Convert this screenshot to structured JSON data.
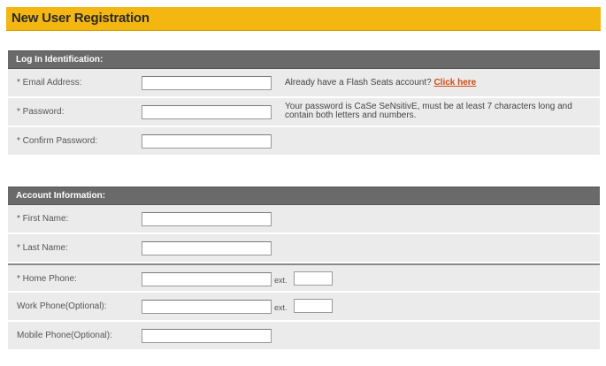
{
  "page": {
    "title": "New User Registration"
  },
  "login_section": {
    "header": "Log In Identification:",
    "email_label": "* Email Address:",
    "email_value": "",
    "account_note": "Already have a Flash Seats account?",
    "click_here": "Click here",
    "password_label": "* Password:",
    "password_value": "",
    "password_note": "Your password is CaSe SeNsitivE, must be at least 7 characters long and contain both letters and numbers.",
    "confirm_label": "* Confirm Password:",
    "confirm_value": ""
  },
  "account_section": {
    "header": "Account Information:",
    "first_name_label": "* First Name:",
    "first_name_value": "",
    "last_name_label": "* Last Name:",
    "last_name_value": "",
    "home_phone_label": "* Home Phone:",
    "home_phone_value": "",
    "home_ext_label": "ext.",
    "home_ext_value": "",
    "work_phone_label": "Work Phone(Optional):",
    "work_phone_value": "",
    "work_ext_label": "ext.",
    "work_ext_value": "",
    "mobile_phone_label": "Mobile Phone(Optional):",
    "mobile_phone_value": ""
  },
  "colors": {
    "title_bar": "#f4b611",
    "section_header": "#6a6a6a",
    "row_bg": "#ebebeb",
    "link": "#d24a12"
  }
}
